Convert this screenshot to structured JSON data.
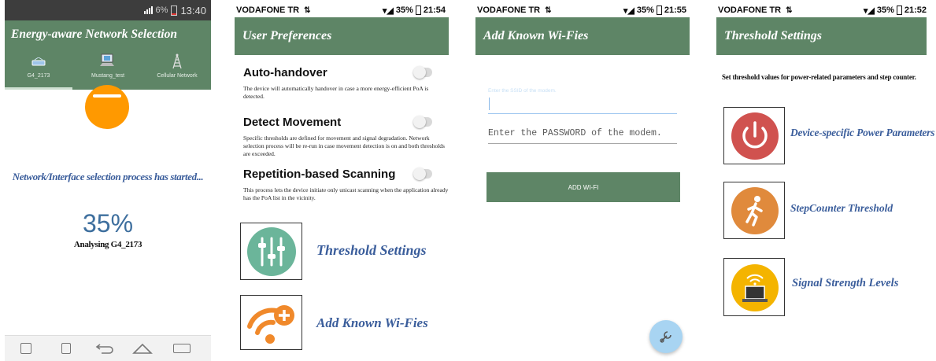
{
  "screen1": {
    "status": {
      "battery": "6%",
      "time": "13:40"
    },
    "title": "Energy-aware Network Selection",
    "tabs": [
      {
        "label": "G4_2173",
        "icon": "wifi-router-icon"
      },
      {
        "label": "Mustang_test",
        "icon": "computer-icon"
      },
      {
        "label": "Cellular Network",
        "icon": "cell-tower-icon"
      }
    ],
    "message": "Network/Interface selection process has started...",
    "progress_text": "35%",
    "progress_value": 35,
    "analysing_text": "Analysing G4_2173",
    "nav_icons": [
      "menu-grid-icon",
      "download-icon",
      "back-icon",
      "home-icon",
      "recent-apps-icon"
    ]
  },
  "screen2": {
    "status": {
      "carrier": "VODAFONE TR",
      "battery": "35%",
      "time": "21:54"
    },
    "title": "User Preferences",
    "prefs": [
      {
        "title": "Auto-handover",
        "desc": "The device will automatically handover in case a more energy-efficient PoA is detected.",
        "enabled": false
      },
      {
        "title": "Detect Movement",
        "desc": "Specific thresholds are defined for movement and signal degradation. Network selection process will be re-run in case movement detection is on and both thresholds are exceeded.",
        "enabled": false
      },
      {
        "title": "Repetition-based Scanning",
        "desc": "This process lets the device initiate only unicast scanning when the application already has the PoA list in the vicinity.",
        "enabled": false
      }
    ],
    "links": [
      {
        "label": "Threshold Settings",
        "icon": "sliders-icon"
      },
      {
        "label": "Add Known Wi-Fies",
        "icon": "wifi-add-icon"
      }
    ]
  },
  "screen3": {
    "status": {
      "carrier": "VODAFONE TR",
      "battery": "35%",
      "time": "21:55"
    },
    "title": "Add Known Wi-Fies",
    "ssid_placeholder": "Enter the SSID of the modem.",
    "password_placeholder": "Enter the PASSWORD of the modem.",
    "add_button": "ADD WI-FI"
  },
  "screen4": {
    "status": {
      "carrier": "VODAFONE TR",
      "battery": "35%",
      "time": "21:52"
    },
    "title": "Threshold Settings",
    "intro": "Set threshold values for power-related parameters and step counter.",
    "items": [
      {
        "label": "Device-specific Power Parameters",
        "icon": "power-icon",
        "color": "#d0524f"
      },
      {
        "label": "StepCounter Threshold",
        "icon": "walking-person-icon",
        "color": "#e08a3c"
      },
      {
        "label": "Signal Strength Levels",
        "icon": "signal-laptop-icon",
        "color": "#f4b400"
      }
    ]
  },
  "colors": {
    "appbar": "#5e8566",
    "link": "#3a5d9b",
    "progress": "#3e6f9e",
    "orange": "#ff9900"
  }
}
